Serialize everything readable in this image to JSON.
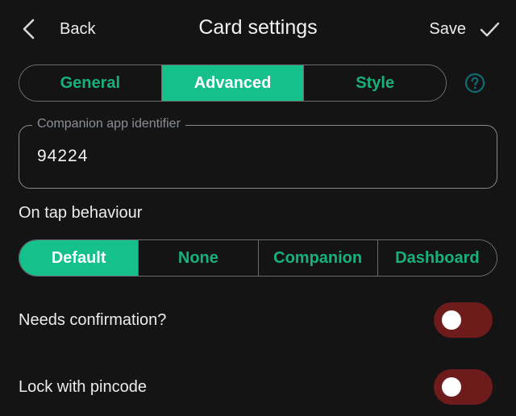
{
  "header": {
    "back_label": "Back",
    "title": "Card settings",
    "save_label": "Save"
  },
  "tabs": [
    {
      "label": "General",
      "active": false
    },
    {
      "label": "Advanced",
      "active": true
    },
    {
      "label": "Style",
      "active": false
    }
  ],
  "companion_field": {
    "label": "Companion app identifier",
    "value": "94224"
  },
  "tap_behaviour": {
    "label": "On tap behaviour",
    "options": [
      {
        "label": "Default",
        "active": true
      },
      {
        "label": "None",
        "active": false
      },
      {
        "label": "Companion",
        "active": false
      },
      {
        "label": "Dashboard",
        "active": false
      }
    ]
  },
  "toggles": [
    {
      "label": "Needs confirmation?",
      "on": false
    },
    {
      "label": "Lock with pincode",
      "on": false
    }
  ],
  "colors": {
    "accent": "#16c08a",
    "toggle_off_track": "#6e1b1b",
    "background": "#141414"
  },
  "icons": {
    "back": "chevron-left-icon",
    "save": "check-icon",
    "help": "help-circle-icon"
  }
}
